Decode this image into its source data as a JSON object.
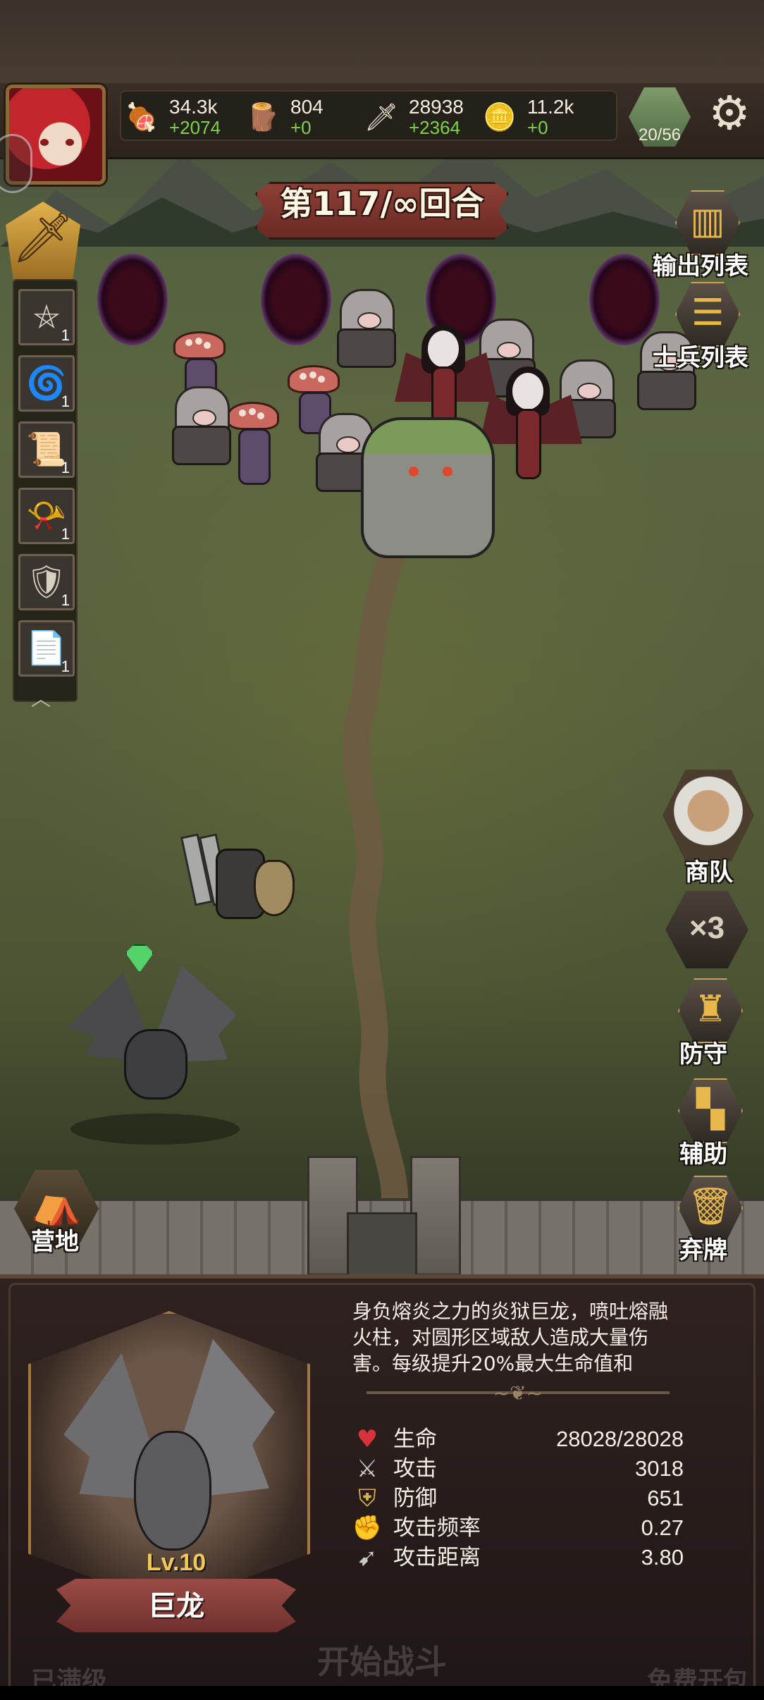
{
  "hud": {
    "resources": [
      {
        "icon": "meat-icon",
        "glyph": "🍖",
        "value": "34.3k",
        "delta": "+2074"
      },
      {
        "icon": "wood-icon",
        "glyph": "🪵",
        "value": "804",
        "delta": "+0"
      },
      {
        "icon": "sword-icon",
        "glyph": "🗡",
        "value": "28938",
        "delta": "+2364"
      },
      {
        "icon": "gold-coin-icon",
        "glyph": "🪙",
        "value": "11.2k",
        "delta": "+0"
      }
    ],
    "population": "20/56"
  },
  "round": {
    "text": "第117/∞回合"
  },
  "skills": [
    {
      "icon": "pentagram-icon",
      "glyph": "⛤",
      "count": "1"
    },
    {
      "icon": "vortex-icon",
      "glyph": "🌀",
      "count": "1"
    },
    {
      "icon": "scroll-map-icon",
      "glyph": "📜",
      "count": "1"
    },
    {
      "icon": "horn-icon",
      "glyph": "📯",
      "count": "1"
    },
    {
      "icon": "shield-icon",
      "glyph": "🛡",
      "count": "1"
    },
    {
      "icon": "parchment-icon",
      "glyph": "📄",
      "count": "1"
    }
  ],
  "right_menu": {
    "output_list": "输出列表",
    "soldier_list": "士兵列表",
    "caravan": "商队",
    "speed": "×3",
    "defense": "防守",
    "assist": "辅助",
    "discard": "弃牌"
  },
  "camp": "营地",
  "unit_info": {
    "description": "身负熔炎之力的炎狱巨龙，喷吐熔融火柱，对圆形区域敌人造成大量伤害。每级提升20%最大生命值和",
    "level": "Lv.10",
    "name": "巨龙",
    "stats": [
      {
        "icon": "heart-icon",
        "glyph": "♥",
        "color": "#d8323a",
        "label": "生命",
        "value": "28028/28028"
      },
      {
        "icon": "crossed-swords-icon",
        "glyph": "⚔",
        "color": "#c9c9c9",
        "label": "攻击",
        "value": "3018"
      },
      {
        "icon": "shield-icon",
        "glyph": "⛨",
        "color": "#d8b24a",
        "label": "防御",
        "value": "651"
      },
      {
        "icon": "fist-icon",
        "glyph": "✊",
        "color": "#e0b089",
        "label": "攻击频率",
        "value": "0.27"
      },
      {
        "icon": "arrow-range-icon",
        "glyph": "➹",
        "color": "#c9c9c9",
        "label": "攻击距离",
        "value": "3.80"
      }
    ]
  },
  "faded_buttons": {
    "maxed": "已满级",
    "start_battle": "开始战斗",
    "free_pack": "免费开包"
  }
}
